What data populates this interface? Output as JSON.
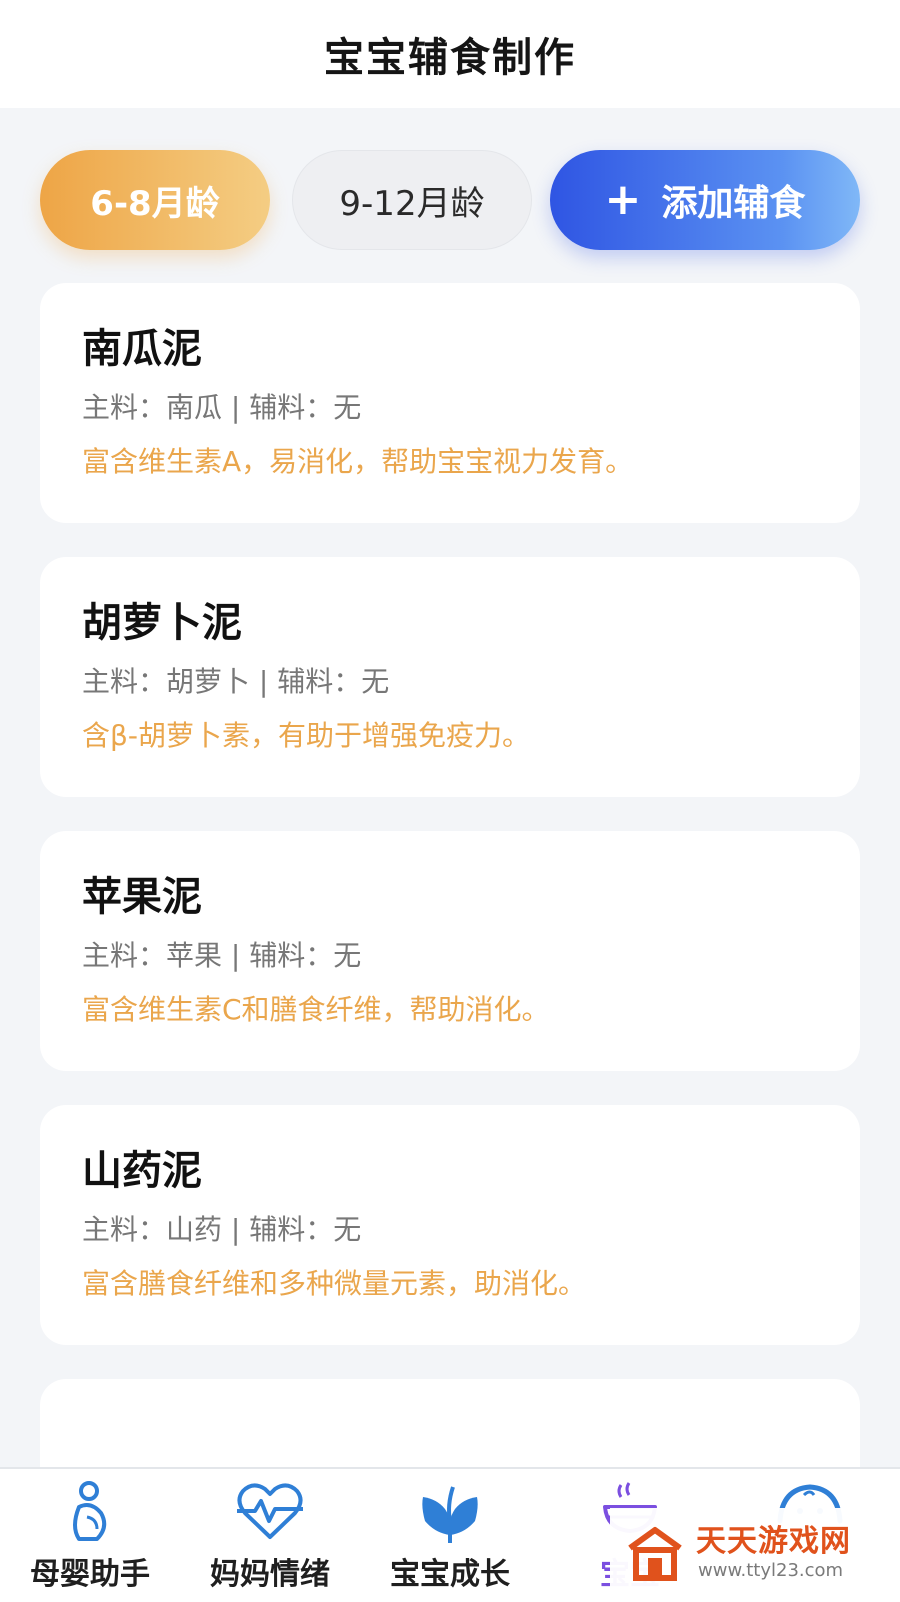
{
  "header": {
    "title": "宝宝辅食制作"
  },
  "filters": {
    "age_6_8": "6-8月龄",
    "age_9_12": "9-12月龄",
    "add_icon": "+",
    "add_label": "添加辅食"
  },
  "recipes": [
    {
      "name": "南瓜泥",
      "ingredients": "主料：南瓜 | 辅料：无",
      "desc": "富含维生素A，易消化，帮助宝宝视力发育。"
    },
    {
      "name": "胡萝卜泥",
      "ingredients": "主料：胡萝卜 | 辅料：无",
      "desc": "含β-胡萝卜素，有助于增强免疫力。"
    },
    {
      "name": "苹果泥",
      "ingredients": "主料：苹果 | 辅料：无",
      "desc": "富含维生素C和膳食纤维，帮助消化。"
    },
    {
      "name": "山药泥",
      "ingredients": "主料：山药 | 辅料：无",
      "desc": "富含膳食纤维和多种微量元素，助消化。"
    }
  ],
  "nav": [
    {
      "label": "母婴助手",
      "icon": "pregnant-mother-icon"
    },
    {
      "label": "妈妈情绪",
      "icon": "heart-pulse-icon"
    },
    {
      "label": "宝宝成长",
      "icon": "sprout-icon"
    },
    {
      "label": "宝宝",
      "icon": "bowl-icon",
      "active": true
    },
    {
      "label": "",
      "icon": "baby-face-icon"
    }
  ],
  "watermark": {
    "title": "天天游戏网",
    "url": "www.ttyl23.com"
  },
  "colors": {
    "accent_orange": "#eaa64c",
    "accent_blue": "#2f55e3",
    "active_nav": "#7b4fe0",
    "icon_blue": "#2f7fd6"
  }
}
